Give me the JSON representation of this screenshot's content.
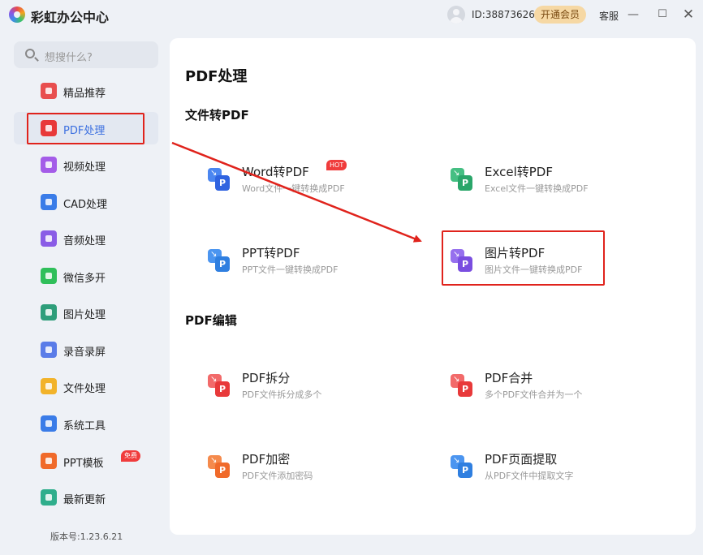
{
  "app": {
    "title": "彩虹办公中心"
  },
  "header": {
    "user_id": "ID:38873626",
    "vip_label": "开通会员",
    "service_label": "客服"
  },
  "search": {
    "placeholder": "想搜什么?"
  },
  "sidebar": {
    "items": [
      {
        "label": "精品推荐",
        "icon": "thumbs-up-icon",
        "color": "#e84e4e"
      },
      {
        "label": "PDF处理",
        "icon": "pdf-icon",
        "color": "#e8393a",
        "active": true
      },
      {
        "label": "视频处理",
        "icon": "video-icon",
        "color": "#a45ce8"
      },
      {
        "label": "CAD处理",
        "icon": "cad-icon",
        "color": "#3a7ce8"
      },
      {
        "label": "音频处理",
        "icon": "music-icon",
        "color": "#8a5ce6"
      },
      {
        "label": "微信多开",
        "icon": "wechat-icon",
        "color": "#2fbf5a"
      },
      {
        "label": "图片处理",
        "icon": "image-icon",
        "color": "#2e9e7a"
      },
      {
        "label": "录音录屏",
        "icon": "microphone-icon",
        "color": "#5a7ce8"
      },
      {
        "label": "文件处理",
        "icon": "folder-icon",
        "color": "#f2b32a"
      },
      {
        "label": "系统工具",
        "icon": "gear-icon",
        "color": "#3a7ce8"
      },
      {
        "label": "PPT模板",
        "icon": "ppt-icon",
        "color": "#f06a2a",
        "badge": "免费"
      },
      {
        "label": "最新更新",
        "icon": "upload-icon",
        "color": "#2fae8c"
      }
    ],
    "version": "版本号:1.23.6.21"
  },
  "main": {
    "title": "PDF处理",
    "sections": [
      {
        "title": "文件转PDF",
        "tools": [
          {
            "name": "Word转PDF",
            "desc": "Word文件一键转换成PDF",
            "badge": "HOT",
            "color": "#2f63e0",
            "color2": "#4b86f0",
            "icon": "word-to-pdf-icon"
          },
          {
            "name": "Excel转PDF",
            "desc": "Excel文件一键转换成PDF",
            "color": "#2aa66a",
            "color2": "#45bf83",
            "icon": "excel-to-pdf-icon"
          },
          {
            "name": "PPT转PDF",
            "desc": "PPT文件一键转换成PDF",
            "color": "#2f7fe0",
            "color2": "#4b95f0",
            "icon": "ppt-to-pdf-icon"
          },
          {
            "name": "图片转PDF",
            "desc": "图片文件一键转换成PDF",
            "color": "#7a4ee0",
            "color2": "#9670ee",
            "icon": "image-to-pdf-icon"
          }
        ]
      },
      {
        "title": "PDF编辑",
        "tools": [
          {
            "name": "PDF拆分",
            "desc": "PDF文件拆分成多个",
            "color": "#e8393a",
            "color2": "#f26a6a",
            "icon": "pdf-split-icon"
          },
          {
            "name": "PDF合并",
            "desc": "多个PDF文件合并为一个",
            "color": "#e8393a",
            "color2": "#f26a6a",
            "icon": "pdf-merge-icon"
          },
          {
            "name": "PDF加密",
            "desc": "PDF文件添加密码",
            "color": "#f06a2a",
            "color2": "#f58a4c",
            "icon": "pdf-lock-icon"
          },
          {
            "name": "PDF页面提取",
            "desc": "从PDF文件中提取文字",
            "color": "#2f7fe0",
            "color2": "#4b95f0",
            "icon": "pdf-extract-icon"
          }
        ]
      }
    ]
  }
}
